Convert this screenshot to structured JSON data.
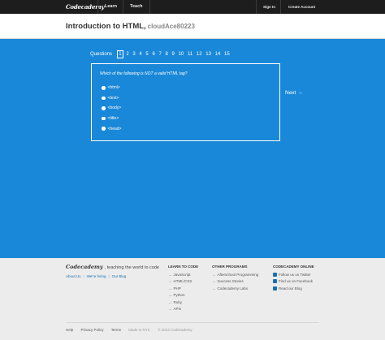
{
  "nav": {
    "logo": "Codecademy",
    "links": [
      "Learn",
      "Teach"
    ],
    "sign_in": "Sign In",
    "create_account": "Create Account"
  },
  "header": {
    "title": "Introduction to HTML,",
    "user": "cloudAce80223"
  },
  "quiz": {
    "questions_label": "Questions",
    "numbers": [
      "1",
      "2",
      "3",
      "4",
      "5",
      "6",
      "7",
      "8",
      "9",
      "10",
      "11",
      "12",
      "13",
      "14",
      "15"
    ],
    "active": "1",
    "prompt": "Which of the following is NOT a valid HTML tag?",
    "options": [
      "<html>",
      "<text>",
      "<body>",
      "<title>",
      "<head>"
    ],
    "next_label": "Next →"
  },
  "footer": {
    "logo": "Codecademy",
    "tagline": ", teaching the world to code",
    "links": [
      "About Us",
      "We're hiring",
      "Our Blog"
    ],
    "learn": {
      "heading": "LEARN TO CODE",
      "items": [
        "JavaScript",
        "HTML/CSS",
        "PHP",
        "Python",
        "Ruby",
        "APIs"
      ]
    },
    "programs": {
      "heading": "OTHER PROGRAMS",
      "items": [
        "Afterschool Programming",
        "Success Stories",
        "Codecademy Labs"
      ]
    },
    "online": {
      "heading": "CODECADEMY ONLINE",
      "items": [
        "Follow us on Twitter",
        "Find us on Facebook",
        "Read our Blog"
      ]
    },
    "bottom": {
      "help": "Help",
      "privacy": "Privacy Policy",
      "terms": "Terms",
      "made_in": "Made in NYC",
      "copyright": "© 2013 Codecademy"
    }
  },
  "colors": {
    "nav_bg": "#1d1d1d",
    "exercise_bg": "#1a88d8",
    "footer_bg": "#ececec",
    "link": "#1a6fb0"
  }
}
